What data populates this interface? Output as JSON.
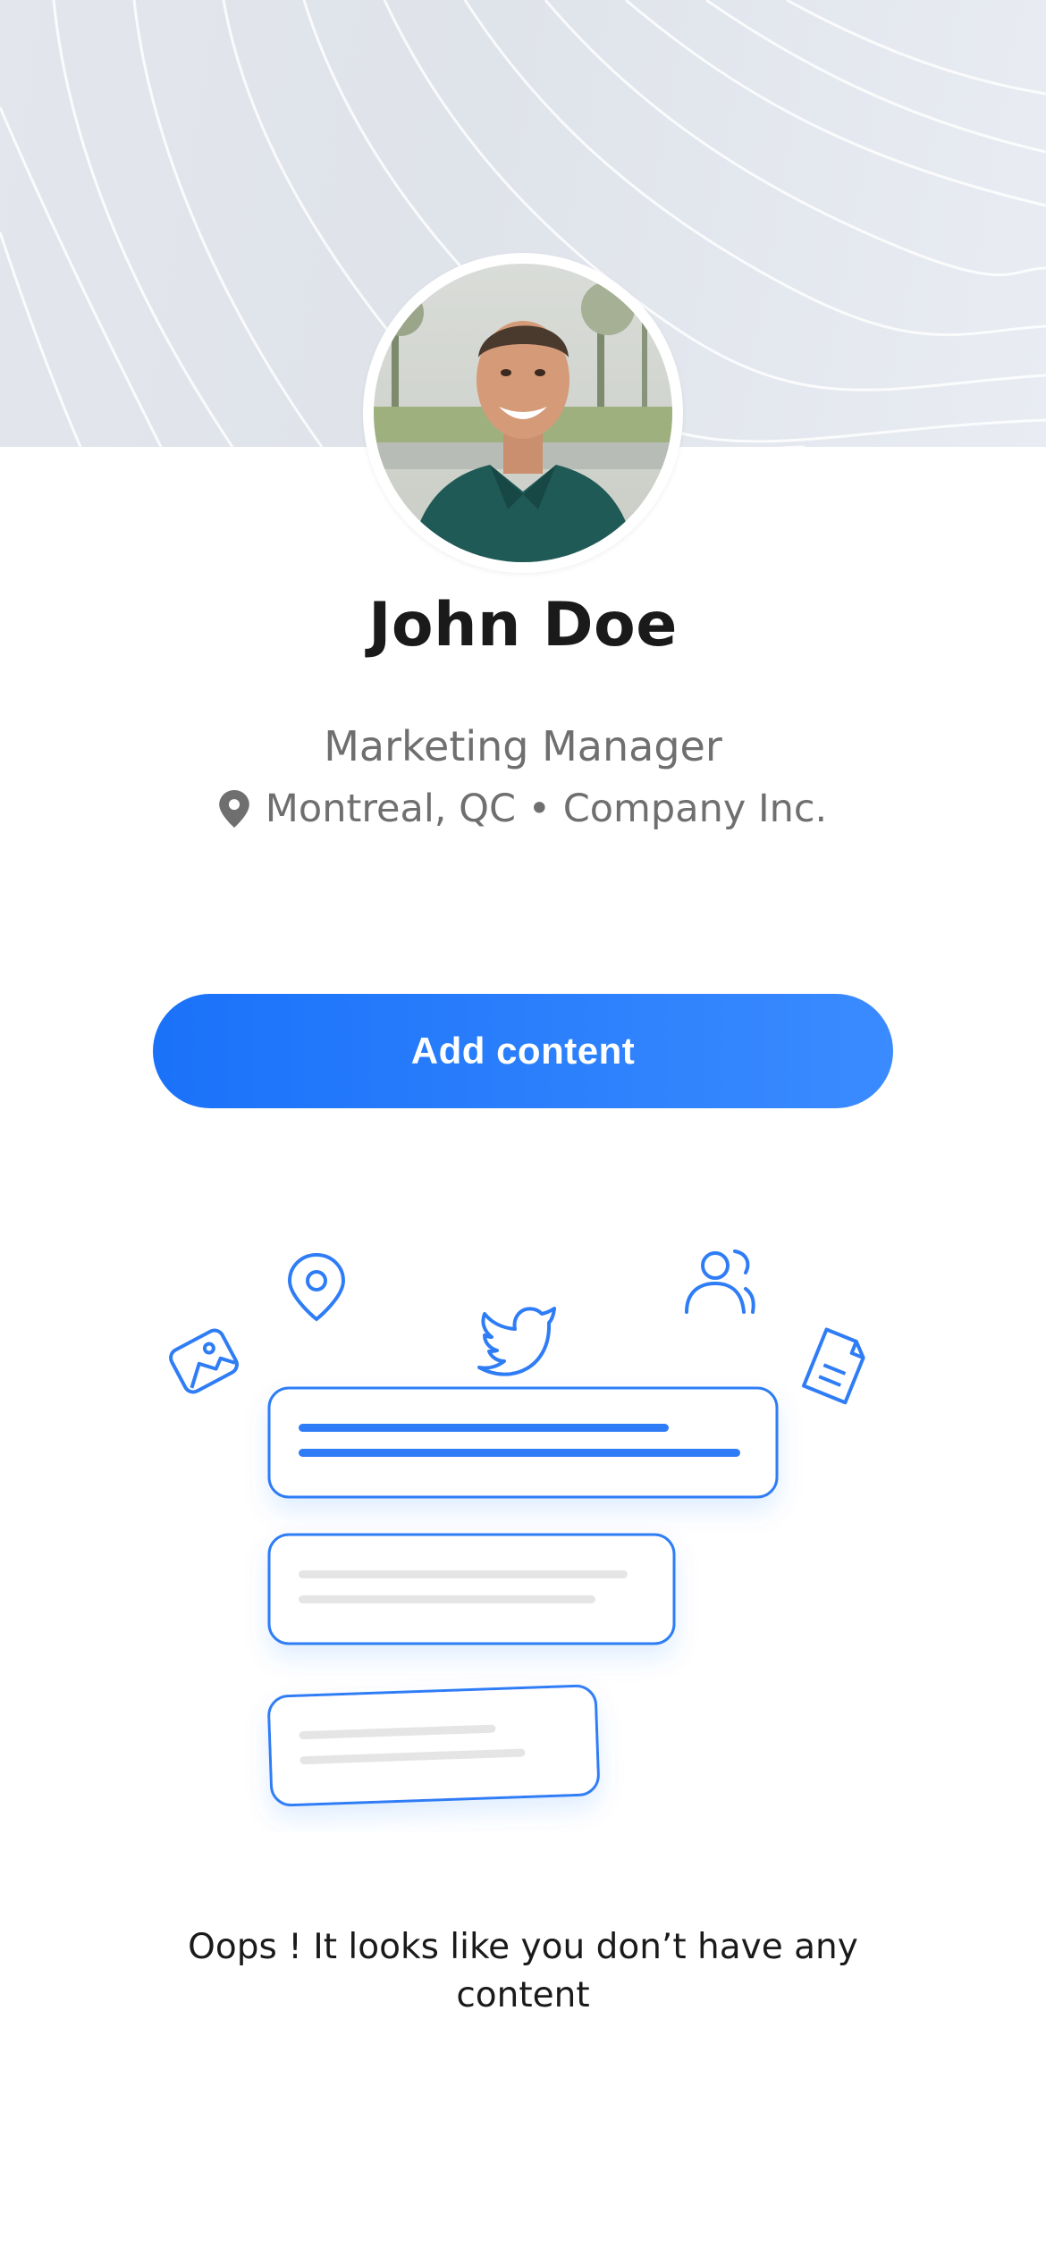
{
  "profile": {
    "name": "John Doe",
    "title": "Marketing Manager",
    "location": "Montreal, QC • Company Inc."
  },
  "actions": {
    "add_content_label": "Add content"
  },
  "empty_state": {
    "message": "Oops ! It looks like you don’t have any content"
  },
  "colors": {
    "accent": "#1a72f9",
    "text_primary": "#1a1a1a",
    "text_secondary": "#6f6f6f"
  },
  "icons": {
    "location": "map-pin-icon",
    "illustration": [
      "image-icon",
      "location-pin-icon",
      "twitter-bird-icon",
      "users-icon",
      "document-icon"
    ]
  }
}
